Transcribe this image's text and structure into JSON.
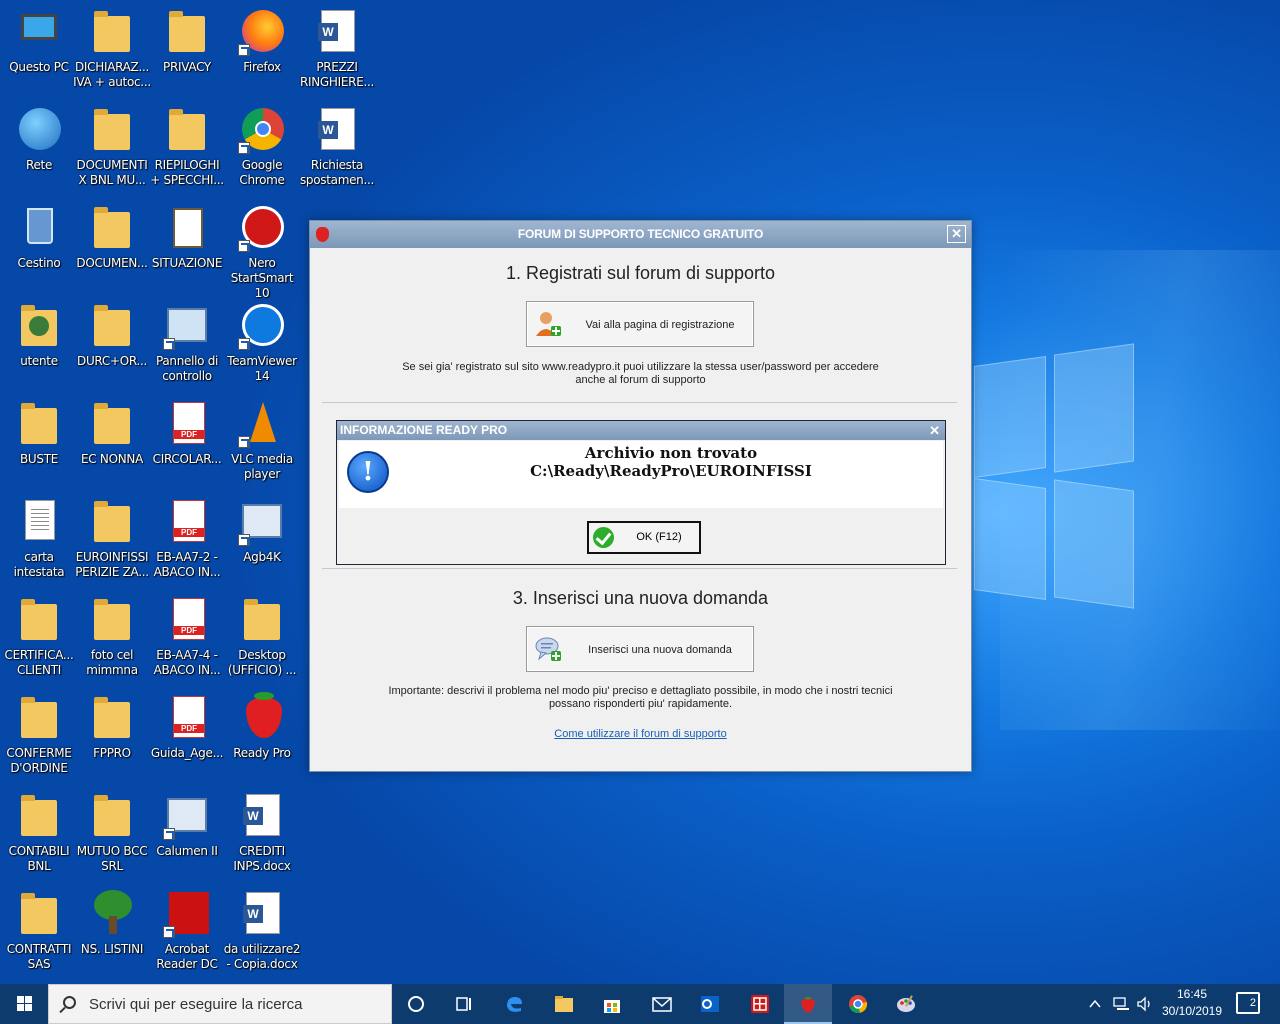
{
  "desktop": {
    "icons": [
      {
        "label": "Questo PC",
        "icon": "computer-icon"
      },
      {
        "label": "Rete",
        "icon": "network-icon"
      },
      {
        "label": "Cestino",
        "icon": "recycle-bin-icon"
      },
      {
        "label": "utente",
        "icon": "user-folder-icon"
      },
      {
        "label": "BUSTE",
        "icon": "folder-icon"
      },
      {
        "label": "carta\nintestata",
        "icon": "document-icon"
      },
      {
        "label": "CERTIFICA...\nCLIENTI",
        "icon": "folder-icon"
      },
      {
        "label": "CONFERME\nD'ORDINE",
        "icon": "folder-icon"
      },
      {
        "label": "CONTABILI\nBNL",
        "icon": "folder-icon"
      },
      {
        "label": "CONTRATTI\nSAS",
        "icon": "folder-icon"
      },
      {
        "label": "DICHIARAZ...\nIVA + autoc...",
        "icon": "folder-icon"
      },
      {
        "label": "DOCUMENTI\nX BNL MU...",
        "icon": "folder-icon"
      },
      {
        "label": "DOCUMEN...",
        "icon": "folder-icon"
      },
      {
        "label": "DURC+OR...",
        "icon": "folder-icon"
      },
      {
        "label": "EC NONNA",
        "icon": "folder-icon"
      },
      {
        "label": "EUROINFISSI\nPERIZIE ZA...",
        "icon": "folder-icon"
      },
      {
        "label": "foto cel\nmimmna",
        "icon": "folder-icon"
      },
      {
        "label": "FPPRO",
        "icon": "folder-icon"
      },
      {
        "label": "MUTUO BCC\nSRL",
        "icon": "folder-icon"
      },
      {
        "label": "NS. LISTINI",
        "icon": "tree-icon"
      },
      {
        "label": "PRIVACY",
        "icon": "folder-icon"
      },
      {
        "label": "RIEPILOGHI\n+ SPECCHI...",
        "icon": "folder-icon"
      },
      {
        "label": "SITUAZIONE",
        "icon": "clipboard-icon"
      },
      {
        "label": "Pannello di\ncontrollo",
        "icon": "control-panel-icon"
      },
      {
        "label": "CIRCOLAR...",
        "icon": "pdf-icon"
      },
      {
        "label": "EB-AA7-2 -\nABACO IN...",
        "icon": "pdf-icon"
      },
      {
        "label": "EB-AA7-4 -\nABACO IN...",
        "icon": "pdf-icon"
      },
      {
        "label": "Guida_Age...",
        "icon": "pdf-icon"
      },
      {
        "label": "Calumen II",
        "icon": "window-icon"
      },
      {
        "label": "Acrobat\nReader DC",
        "icon": "acrobat-icon"
      },
      {
        "label": "Firefox",
        "icon": "firefox-icon"
      },
      {
        "label": "Google\nChrome",
        "icon": "chrome-icon"
      },
      {
        "label": "Nero\nStartSmart 10",
        "icon": "nero-icon"
      },
      {
        "label": "TeamViewer\n14",
        "icon": "teamviewer-icon"
      },
      {
        "label": "VLC media\nplayer",
        "icon": "vlc-icon"
      },
      {
        "label": "Agb4K",
        "icon": "window-icon"
      },
      {
        "label": "Desktop\n(UFFICIO) ...",
        "icon": "folder-icon"
      },
      {
        "label": "Ready Pro",
        "icon": "strawberry-icon"
      },
      {
        "label": "CREDITI\nINPS.docx",
        "icon": "word-icon"
      },
      {
        "label": "da utilizzare2\n- Copia.docx",
        "icon": "word-icon"
      },
      {
        "label": "PREZZI\nRINGHIERE...",
        "icon": "word-icon"
      },
      {
        "label": "Richiesta\nspostamen...",
        "icon": "word-icon"
      }
    ]
  },
  "support_dialog": {
    "title": "FORUM DI SUPPORTO TECNICO GRATUITO",
    "close": "✕",
    "step1_title": "1. Registrati sul forum di supporto",
    "register_button": "Vai alla pagina di registrazione",
    "register_note_1": "Se sei gia' registrato sul sito www.readypro.it puoi utilizzare la stessa user/password per accedere",
    "register_note_2": "anche al forum di supporto",
    "step3_title": "3. Inserisci una nuova domanda",
    "new_question_button": "Inserisci una nuova domanda",
    "important_note_1": "Importante: descrivi il problema nel modo piu' preciso e dettagliato possibile, in modo che i nostri tecnici",
    "important_note_2": "possano risponderti piu' rapidamente.",
    "help_link": "Come utilizzare il forum di supporto"
  },
  "info_dialog": {
    "title": "INFORMAZIONE READY PRO",
    "close": "✕",
    "message_1": "Archivio non trovato",
    "message_2": "C:\\Ready\\ReadyPro\\EUROINFISSI",
    "ok_button": "OK (F12)"
  },
  "taskbar": {
    "search_placeholder": "Scrivi qui per eseguire la ricerca",
    "time": "16:45",
    "date": "30/10/2019",
    "notification_count": "2"
  }
}
